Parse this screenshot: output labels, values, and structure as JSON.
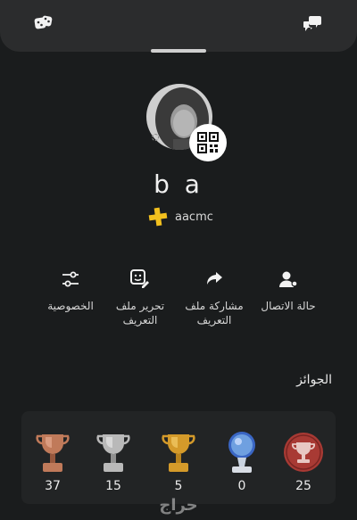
{
  "header": {
    "left_icon": "game-controller-icon",
    "right_icon": "chat-bubbles-icon"
  },
  "profile": {
    "username": "b a",
    "plus_badge_icon": "playstation-plus-icon",
    "online_id": "aacmc",
    "qr_icon": "qr-code-icon",
    "status_icon": "status-offline-icon"
  },
  "actions": [
    {
      "id": "connection-status",
      "label": "حالة الاتصال",
      "icon": "person-status-icon"
    },
    {
      "id": "share-profile",
      "label": "مشاركة ملف التعريف",
      "icon": "share-arrow-icon"
    },
    {
      "id": "edit-profile",
      "label": "تحرير ملف التعريف",
      "icon": "edit-profile-icon"
    },
    {
      "id": "privacy",
      "label": "الخصوصية",
      "icon": "sliders-icon"
    }
  ],
  "trophies": {
    "title": "الجوائز",
    "items": [
      {
        "id": "level",
        "count": "25",
        "icon": "trophy-level-icon",
        "color": "#a83a34"
      },
      {
        "id": "platinum",
        "count": "0",
        "icon": "platinum-trophy-icon",
        "color": "#6fa0e0"
      },
      {
        "id": "gold",
        "count": "5",
        "icon": "gold-trophy-icon",
        "color": "#d49a2a"
      },
      {
        "id": "silver",
        "count": "15",
        "icon": "silver-trophy-icon",
        "color": "#b9b9b9"
      },
      {
        "id": "bronze",
        "count": "37",
        "icon": "bronze-trophy-icon",
        "color": "#c07a5a"
      }
    ]
  },
  "watermark": "حراج"
}
